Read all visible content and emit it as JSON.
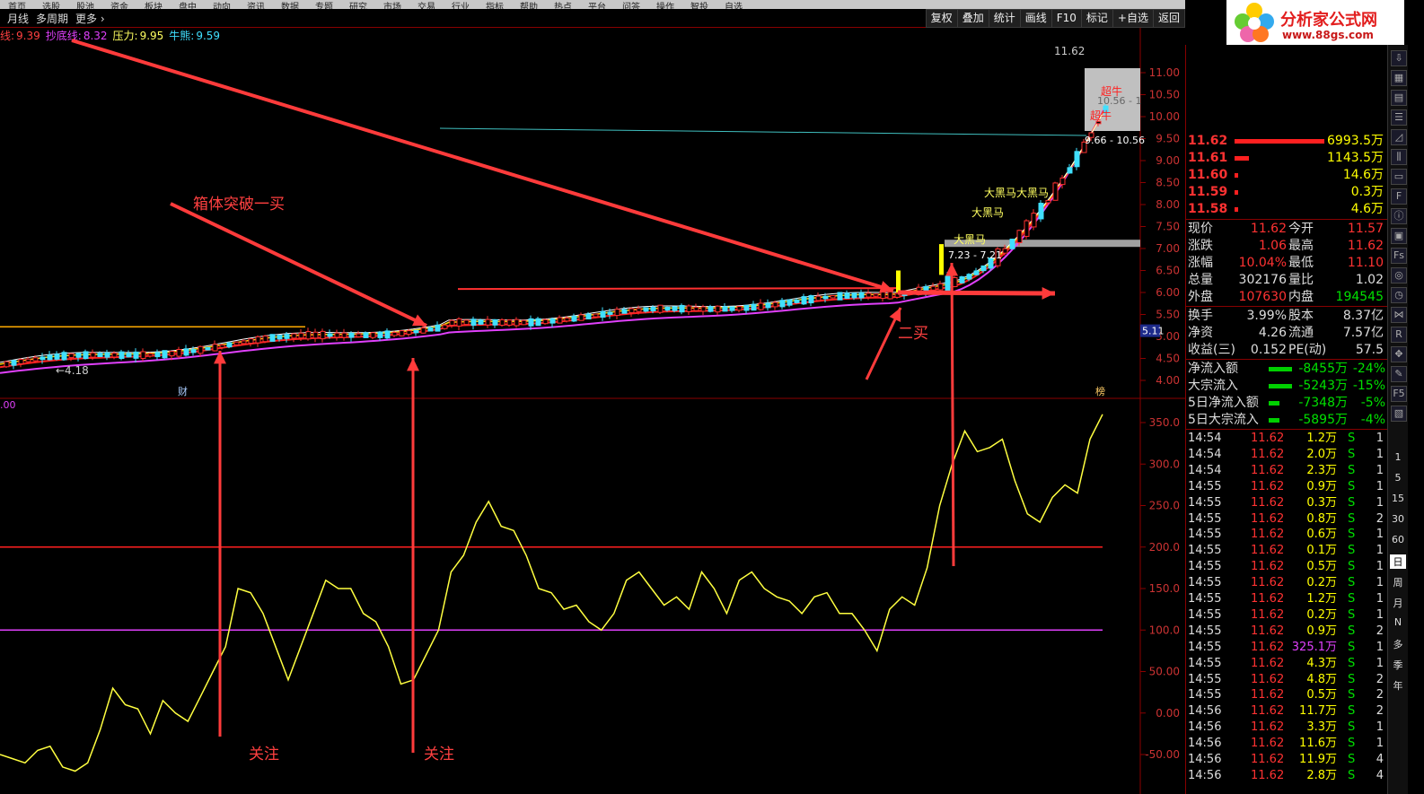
{
  "menu": {
    "top_labels": [
      "首页",
      "选股",
      "股池",
      "资金",
      "板块",
      "盘中",
      "动向",
      "资讯",
      "数据",
      "专题",
      "研究",
      "市场",
      "交易",
      "行业",
      "指标",
      "帮助",
      "热点",
      "平台",
      "问答",
      "操作",
      "智投",
      "自选"
    ],
    "items": [
      "月线",
      "多周期",
      "更多 ›"
    ],
    "toolbar": [
      "复权",
      "叠加",
      "统计",
      "画线",
      "F10",
      "标记",
      "+自选",
      "返回"
    ]
  },
  "indicators": [
    {
      "label": "线:",
      "value": "9.39",
      "color": "#ff4040"
    },
    {
      "label": "抄底线:",
      "value": "8.32",
      "color": "#e040fb"
    },
    {
      "label": "压力:",
      "value": "9.95",
      "color": "#ffff60"
    },
    {
      "label": "牛熊:",
      "value": "9.59",
      "color": "#40e0ff"
    }
  ],
  "logo": {
    "title": "分析家公式网",
    "url": "www.88gs.com"
  },
  "price_axis": [
    "11.00",
    "10.50",
    "10.00",
    "9.50",
    "9.00",
    "8.50",
    "8.00",
    "7.50",
    "7.00",
    "6.50",
    "6.00",
    "5.50",
    "5.00",
    "4.50",
    "4.00"
  ],
  "price_tag": "5.11",
  "osc_axis": [
    "350.0",
    "300.0",
    "250.0",
    "200.0",
    "150.0",
    "100.0",
    "50.00",
    "0.00",
    "-50.00"
  ],
  "osc_left_label": ".00",
  "chart_labels": {
    "high_price": "11.62",
    "low_price": "4.18",
    "box_label": "9.66 - 10.56",
    "box_label2": "10.56 - 1",
    "low_box": "7.23 - 7.21",
    "chao_niu": "超牛",
    "da_hei_ma": "大黑马",
    "cai": "财",
    "bang": "榜"
  },
  "annotations": {
    "breakout": "箱体突破一买",
    "second_buy": "二买",
    "watch1": "关注",
    "watch2": "关注"
  },
  "quote": {
    "order_book": [
      {
        "price": "11.62",
        "vol": "6993.5万",
        "bar": 1.0
      },
      {
        "price": "11.61",
        "vol": "1143.5万",
        "bar": 0.16
      },
      {
        "price": "11.60",
        "vol": "14.6万",
        "bar": 0.01
      },
      {
        "price": "11.59",
        "vol": "0.3万",
        "bar": 0.01
      },
      {
        "price": "11.58",
        "vol": "4.6万",
        "bar": 0.01
      }
    ],
    "stats": [
      {
        "l1": "现价",
        "v1": "11.62",
        "l2": "今开",
        "v2": "11.57"
      },
      {
        "l1": "涨跌",
        "v1": "1.06",
        "l2": "最高",
        "v2": "11.62"
      },
      {
        "l1": "涨幅",
        "v1": "10.04%",
        "l2": "最低",
        "v2": "11.10"
      },
      {
        "l1": "总量",
        "v1": "302176",
        "l2": "量比",
        "v2": "1.02"
      },
      {
        "l1": "外盘",
        "v1": "107630",
        "l2": "内盘",
        "v2": "194545"
      },
      {
        "l1": "换手",
        "v1": "3.99%",
        "l2": "股本",
        "v2": "8.37亿"
      },
      {
        "l1": "净资",
        "v1": "4.26",
        "l2": "流通",
        "v2": "7.57亿"
      },
      {
        "l1": "收益(三)",
        "v1": "0.152",
        "l2": "PE(动)",
        "v2": "57.5"
      }
    ],
    "flows": [
      {
        "label": "净流入额",
        "value": "-8455万",
        "pct": "-24%"
      },
      {
        "label": "大宗流入",
        "value": "-5243万",
        "pct": "-15%"
      },
      {
        "label": "5日净流入额",
        "value": "-7348万",
        "pct": "-5%"
      },
      {
        "label": "5日大宗流入",
        "value": "-5895万",
        "pct": "-4%"
      }
    ],
    "ticks": [
      {
        "time": "14:54",
        "price": "11.62",
        "vol": "1.2万",
        "side": "S",
        "n": "1"
      },
      {
        "time": "14:54",
        "price": "11.62",
        "vol": "2.0万",
        "side": "S",
        "n": "1"
      },
      {
        "time": "14:54",
        "price": "11.62",
        "vol": "2.3万",
        "side": "S",
        "n": "1"
      },
      {
        "time": "14:55",
        "price": "11.62",
        "vol": "0.9万",
        "side": "S",
        "n": "1"
      },
      {
        "time": "14:55",
        "price": "11.62",
        "vol": "0.3万",
        "side": "S",
        "n": "1"
      },
      {
        "time": "14:55",
        "price": "11.62",
        "vol": "0.8万",
        "side": "S",
        "n": "2"
      },
      {
        "time": "14:55",
        "price": "11.62",
        "vol": "0.6万",
        "side": "S",
        "n": "1"
      },
      {
        "time": "14:55",
        "price": "11.62",
        "vol": "0.1万",
        "side": "S",
        "n": "1"
      },
      {
        "time": "14:55",
        "price": "11.62",
        "vol": "0.5万",
        "side": "S",
        "n": "1"
      },
      {
        "time": "14:55",
        "price": "11.62",
        "vol": "0.2万",
        "side": "S",
        "n": "1"
      },
      {
        "time": "14:55",
        "price": "11.62",
        "vol": "1.2万",
        "side": "S",
        "n": "1"
      },
      {
        "time": "14:55",
        "price": "11.62",
        "vol": "0.2万",
        "side": "S",
        "n": "1"
      },
      {
        "time": "14:55",
        "price": "11.62",
        "vol": "0.9万",
        "side": "S",
        "n": "2"
      },
      {
        "time": "14:55",
        "price": "11.62",
        "vol": "325.1万",
        "side": "S",
        "n": "1",
        "big": true
      },
      {
        "time": "14:55",
        "price": "11.62",
        "vol": "4.3万",
        "side": "S",
        "n": "1"
      },
      {
        "time": "14:55",
        "price": "11.62",
        "vol": "4.8万",
        "side": "S",
        "n": "2"
      },
      {
        "time": "14:55",
        "price": "11.62",
        "vol": "0.5万",
        "side": "S",
        "n": "2"
      },
      {
        "time": "14:56",
        "price": "11.62",
        "vol": "11.7万",
        "side": "S",
        "n": "2"
      },
      {
        "time": "14:56",
        "price": "11.62",
        "vol": "3.3万",
        "side": "S",
        "n": "1"
      },
      {
        "time": "14:56",
        "price": "11.62",
        "vol": "11.6万",
        "side": "S",
        "n": "1"
      },
      {
        "time": "14:56",
        "price": "11.62",
        "vol": "11.9万",
        "side": "S",
        "n": "4"
      },
      {
        "time": "14:56",
        "price": "11.62",
        "vol": "2.8万",
        "side": "S",
        "n": "4"
      }
    ]
  },
  "side_icons": [
    "arrow-down-icon",
    "grid-icon",
    "table-icon",
    "list-icon",
    "chart-icon",
    "kline-icon",
    "doc-icon",
    "f10-icon",
    "info-icon",
    "book-icon",
    "fs-icon",
    "ring-icon",
    "clock-icon",
    "macd-icon",
    "rsi-icon",
    "compass-icon",
    "pen-icon",
    "f5-icon",
    "photo-icon"
  ],
  "periods": [
    "1",
    "5",
    "15",
    "30",
    "60",
    "日",
    "周",
    "月",
    "N",
    "多",
    "季",
    "年"
  ],
  "osc_series": [
    -50,
    -55,
    -60,
    -45,
    -40,
    -65,
    -70,
    -60,
    -20,
    30,
    10,
    5,
    -25,
    15,
    0,
    -10,
    20,
    50,
    80,
    150,
    145,
    120,
    80,
    40,
    80,
    120,
    160,
    150,
    150,
    120,
    110,
    80,
    35,
    40,
    70,
    100,
    170,
    190,
    230,
    255,
    225,
    220,
    190,
    150,
    145,
    125,
    130,
    110,
    100,
    120,
    160,
    170,
    150,
    130,
    140,
    125,
    170,
    150,
    120,
    160,
    170,
    150,
    140,
    135,
    120,
    140,
    145,
    120,
    120,
    100,
    75,
    125,
    140,
    130,
    175,
    250,
    300,
    340,
    315,
    320,
    330,
    280,
    240,
    230,
    260,
    275,
    265,
    330,
    360
  ]
}
